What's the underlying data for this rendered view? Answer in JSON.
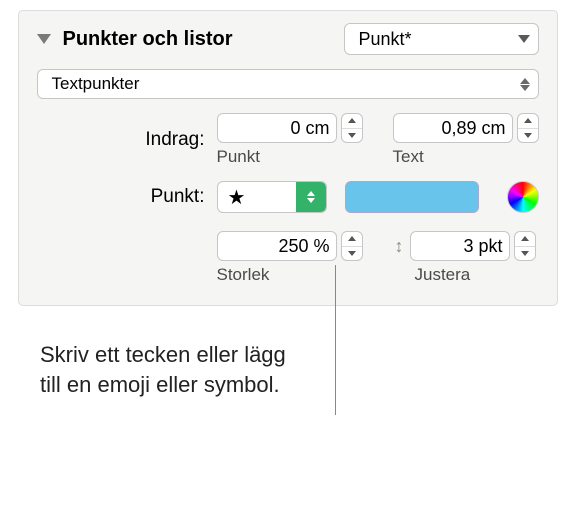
{
  "section": {
    "title": "Punkter och listor",
    "list_style_value": "Punkt*"
  },
  "bullet_type": {
    "value": "Textpunkter"
  },
  "indent": {
    "label": "Indrag:",
    "bullet_value": "0 cm",
    "bullet_sublabel": "Punkt",
    "text_value": "0,89 cm",
    "text_sublabel": "Text"
  },
  "bullet": {
    "label": "Punkt:",
    "symbol": "★"
  },
  "size": {
    "value": "250 %",
    "sublabel": "Storlek"
  },
  "align": {
    "value": "3 pkt",
    "sublabel": "Justera"
  },
  "caption": {
    "line1": "Skriv ett tecken eller lägg",
    "line2": "till en emoji eller symbol."
  }
}
